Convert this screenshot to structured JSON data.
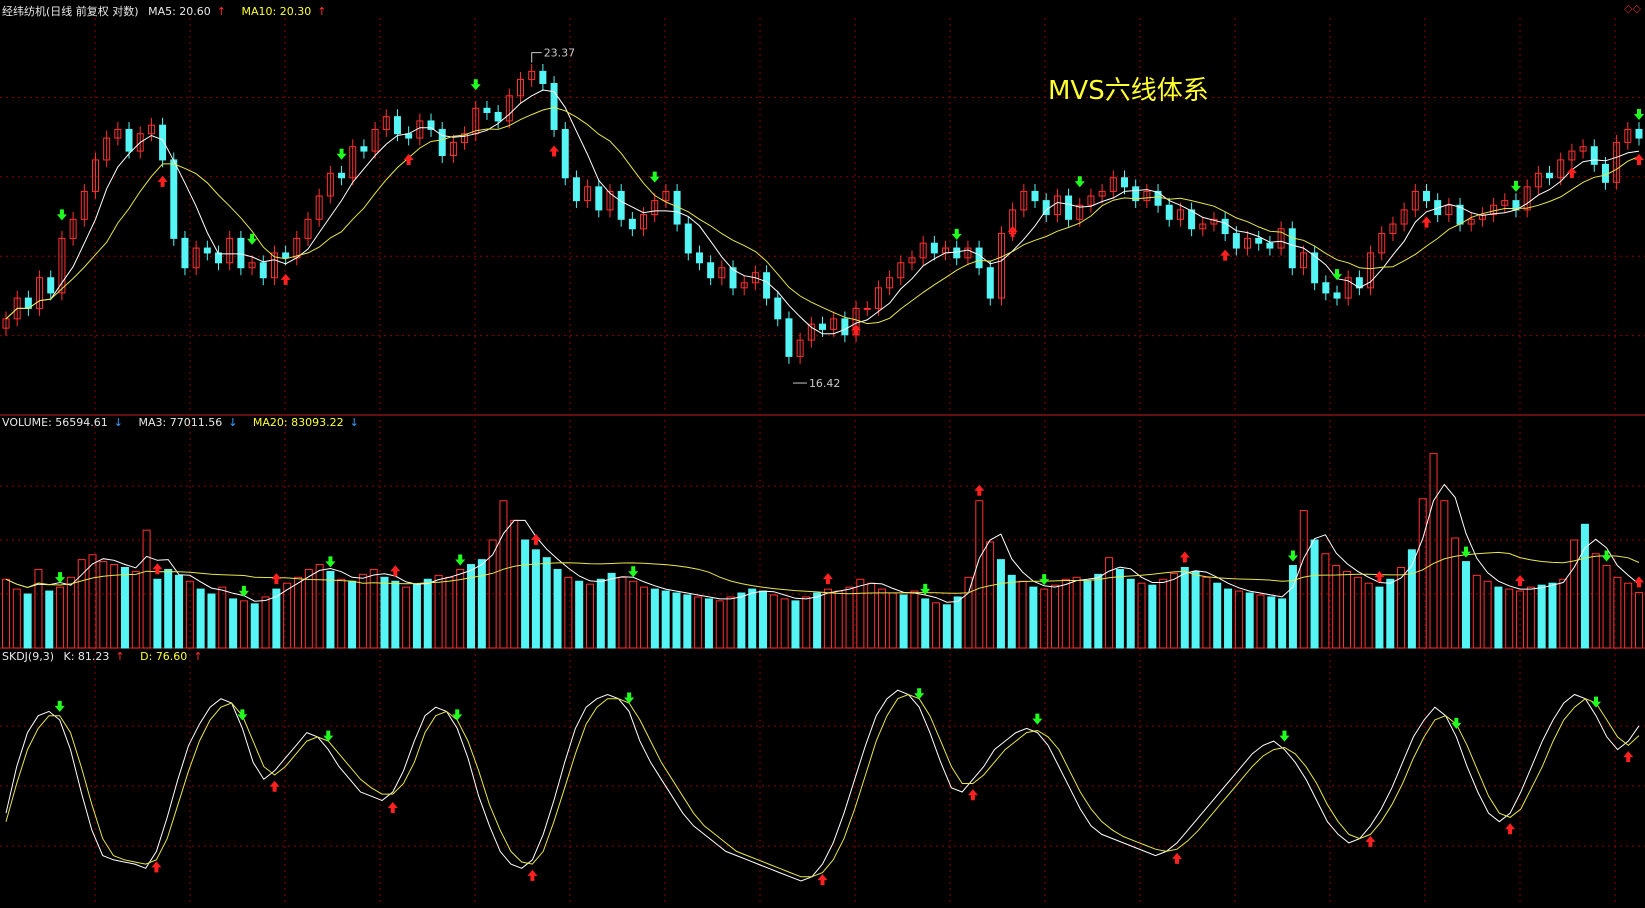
{
  "header_main": {
    "title": "经纬纺机(日线 前复权 对数)",
    "ma5_label": "MA5: 20.60",
    "ma5_arrow": "↑",
    "ma10_label": "MA10: 20.30",
    "ma10_arrow": "↑"
  },
  "header_volume": {
    "volume_label": "VOLUME: 56594.61",
    "volume_arrow": "↓",
    "ma3_label": "MA3: 77011.56",
    "ma3_arrow": "↓",
    "ma20_label": "MA20: 83093.22",
    "ma20_arrow": "↓"
  },
  "header_skdj": {
    "name": "SKDJ(9,3)",
    "k_label": "K: 81.23",
    "k_arrow": "↑",
    "d_label": "D: 76.60",
    "d_arrow": "↑"
  },
  "overlay_title": "MVS六线体系",
  "colors": {
    "up": "#ff3030",
    "down": "#55f5f5",
    "ma_fast": "#ffffff",
    "ma_slow": "#e6e64a",
    "grid": "#8b0000",
    "signal_up": "#ff2020",
    "signal_down": "#20ff20"
  },
  "chart_data": [
    {
      "type": "candlestick",
      "panel": "price",
      "scale": "log",
      "annotations": [
        {
          "text": "23.37",
          "value": 23.37,
          "kind": "high"
        },
        {
          "text": "16.42",
          "value": 16.42,
          "kind": "low"
        }
      ],
      "ylim": [
        16.0,
        24.0
      ],
      "closes": [
        17.6,
        18.0,
        17.8,
        18.4,
        18.1,
        19.2,
        19.6,
        20.2,
        20.9,
        21.4,
        21.6,
        21.1,
        21.5,
        21.7,
        20.9,
        19.2,
        18.6,
        19.0,
        18.9,
        18.7,
        19.2,
        18.6,
        18.7,
        18.4,
        18.9,
        18.8,
        19.2,
        19.6,
        20.1,
        20.6,
        20.5,
        21.2,
        21.1,
        21.6,
        21.9,
        21.5,
        21.4,
        21.8,
        21.6,
        21.0,
        21.3,
        21.5,
        22.1,
        22.0,
        21.8,
        22.4,
        22.8,
        23.0,
        22.7,
        21.6,
        20.5,
        20.0,
        20.3,
        19.8,
        20.2,
        19.6,
        19.4,
        19.7,
        20.0,
        20.2,
        19.5,
        18.9,
        18.7,
        18.4,
        18.6,
        18.2,
        18.3,
        18.5,
        18.0,
        17.6,
        16.9,
        17.2,
        17.5,
        17.4,
        17.6,
        17.3,
        17.8,
        17.8,
        18.2,
        18.4,
        18.7,
        18.8,
        19.1,
        18.9,
        19.0,
        18.8,
        19.0,
        18.6,
        18.0,
        19.3,
        19.8,
        20.2,
        20.0,
        19.7,
        20.1,
        19.6,
        19.9,
        20.1,
        20.2,
        20.5,
        20.3,
        20.0,
        20.2,
        19.9,
        19.6,
        19.8,
        19.4,
        19.5,
        19.6,
        19.3,
        19.0,
        19.2,
        19.1,
        19.0,
        19.4,
        18.6,
        18.9,
        18.3,
        18.1,
        18.0,
        18.4,
        18.2,
        18.9,
        19.3,
        19.5,
        19.8,
        20.2,
        20.0,
        19.7,
        19.9,
        19.5,
        19.6,
        19.7,
        19.9,
        20.0,
        19.8,
        20.3,
        20.6,
        20.5,
        20.9,
        21.1,
        21.2,
        20.8,
        20.4,
        21.3,
        21.6,
        21.4
      ],
      "ma5_last": 20.6,
      "ma10_last": 20.3
    },
    {
      "type": "bar",
      "panel": "volume",
      "ylim": [
        0,
        220000
      ],
      "values": [
        70000,
        60000,
        55000,
        80000,
        58000,
        62000,
        72000,
        90000,
        95000,
        88000,
        85000,
        82000,
        78000,
        120000,
        70000,
        80000,
        74000,
        68000,
        60000,
        55000,
        62000,
        50000,
        48000,
        45000,
        52000,
        60000,
        66000,
        72000,
        80000,
        85000,
        78000,
        70000,
        68000,
        75000,
        80000,
        72000,
        68000,
        62000,
        65000,
        70000,
        74000,
        72000,
        80000,
        85000,
        90000,
        110000,
        150000,
        130000,
        110000,
        100000,
        92000,
        80000,
        72000,
        68000,
        65000,
        70000,
        76000,
        72000,
        68000,
        62000,
        60000,
        58000,
        56000,
        54000,
        52000,
        50000,
        48000,
        52000,
        56000,
        60000,
        58000,
        54000,
        50000,
        48000,
        52000,
        56000,
        60000,
        58000,
        62000,
        70000,
        66000,
        60000,
        56000,
        54000,
        58000,
        50000,
        46000,
        44000,
        52000,
        72000,
        150000,
        108000,
        90000,
        74000,
        68000,
        62000,
        60000,
        64000,
        70000,
        72000,
        68000,
        75000,
        92000,
        80000,
        70000,
        66000,
        64000,
        70000,
        76000,
        82000,
        78000,
        72000,
        66000,
        60000,
        58000,
        56000,
        54000,
        52000,
        50000,
        84000,
        140000,
        110000,
        96000,
        84000,
        78000,
        72000,
        66000,
        62000,
        70000,
        82000,
        100000,
        152000,
        198000,
        150000,
        112000,
        88000,
        74000,
        68000,
        62000,
        60000,
        58000,
        62000,
        64000,
        66000,
        70000,
        110000,
        126000,
        96000,
        84000,
        72000,
        66000,
        56594.61
      ],
      "ma3_last": 77011.56,
      "ma20_last": 83093.22
    },
    {
      "type": "line",
      "panel": "skdj",
      "ylim": [
        0,
        100
      ],
      "series": [
        {
          "name": "K",
          "values": [
            40,
            62,
            78,
            86,
            88,
            84,
            70,
            50,
            32,
            20,
            18,
            17,
            16,
            14,
            22,
            38,
            56,
            72,
            82,
            90,
            94,
            92,
            80,
            64,
            56,
            60,
            66,
            72,
            78,
            76,
            70,
            62,
            56,
            50,
            48,
            46,
            50,
            60,
            74,
            86,
            90,
            88,
            80,
            66,
            48,
            34,
            22,
            16,
            14,
            18,
            30,
            46,
            64,
            80,
            90,
            94,
            96,
            94,
            88,
            74,
            64,
            56,
            48,
            40,
            34,
            30,
            26,
            22,
            20,
            18,
            16,
            14,
            12,
            10,
            8,
            10,
            16,
            26,
            40,
            56,
            72,
            86,
            94,
            98,
            96,
            90,
            78,
            64,
            52,
            50,
            56,
            62,
            70,
            74,
            78,
            80,
            78,
            72,
            62,
            52,
            42,
            34,
            30,
            28,
            26,
            24,
            22,
            20,
            22,
            26,
            32,
            38,
            44,
            50,
            56,
            62,
            68,
            72,
            74,
            70,
            64,
            56,
            46,
            36,
            30,
            26,
            28,
            34,
            42,
            52,
            64,
            76,
            84,
            90,
            86,
            76,
            62,
            50,
            40,
            36,
            40,
            50,
            62,
            74,
            84,
            92,
            96,
            94,
            86,
            76,
            70,
            74,
            81.23
          ]
        },
        {
          "name": "D",
          "values": [
            36,
            54,
            70,
            80,
            86,
            86,
            78,
            62,
            44,
            28,
            20,
            18,
            17,
            16,
            18,
            28,
            44,
            60,
            74,
            84,
            90,
            92,
            86,
            74,
            62,
            58,
            62,
            68,
            74,
            76,
            74,
            68,
            62,
            56,
            52,
            49,
            49,
            54,
            64,
            78,
            86,
            88,
            84,
            74,
            60,
            44,
            32,
            22,
            17,
            16,
            22,
            36,
            52,
            68,
            82,
            90,
            94,
            94,
            92,
            84,
            74,
            64,
            56,
            48,
            40,
            34,
            30,
            26,
            22,
            20,
            18,
            16,
            14,
            12,
            10,
            10,
            12,
            18,
            28,
            42,
            58,
            74,
            86,
            94,
            96,
            94,
            86,
            74,
            62,
            54,
            54,
            58,
            64,
            70,
            74,
            78,
            79,
            76,
            70,
            60,
            50,
            42,
            36,
            32,
            29,
            27,
            25,
            23,
            22,
            23,
            27,
            32,
            38,
            44,
            50,
            56,
            62,
            67,
            70,
            71,
            68,
            62,
            54,
            44,
            36,
            30,
            28,
            30,
            36,
            44,
            54,
            66,
            76,
            84,
            86,
            82,
            72,
            60,
            48,
            40,
            38,
            42,
            52,
            62,
            74,
            84,
            90,
            94,
            92,
            84,
            76,
            72,
            76.6
          ]
        }
      ]
    }
  ]
}
